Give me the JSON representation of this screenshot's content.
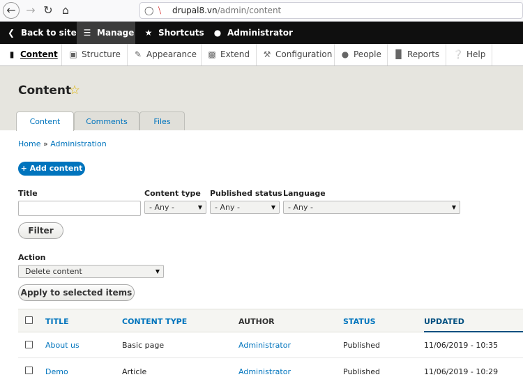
{
  "browser": {
    "url_host": "drupal8.vn",
    "url_path": "/admin/content",
    "back_icon": "back-arrow-icon",
    "forward_icon": "forward-arrow-icon",
    "reload_icon": "reload-icon",
    "home_icon": "home-icon"
  },
  "toolbar": {
    "back_to_site": "Back to site",
    "manage": "Manage",
    "shortcuts": "Shortcuts",
    "user": "Administrator"
  },
  "tray": {
    "items": [
      {
        "label": "Content",
        "icon": "document-icon"
      },
      {
        "label": "Structure",
        "icon": "sitemap-icon"
      },
      {
        "label": "Appearance",
        "icon": "paint-icon"
      },
      {
        "label": "Extend",
        "icon": "puzzle-icon"
      },
      {
        "label": "Configuration",
        "icon": "wrench-icon"
      },
      {
        "label": "People",
        "icon": "people-icon"
      },
      {
        "label": "Reports",
        "icon": "bar-chart-icon"
      },
      {
        "label": "Help",
        "icon": "help-icon"
      }
    ]
  },
  "page": {
    "title": "Content",
    "tabs": [
      {
        "label": "Content"
      },
      {
        "label": "Comments"
      },
      {
        "label": "Files"
      }
    ],
    "breadcrumb": {
      "home": "Home",
      "sep": "»",
      "admin": "Administration"
    },
    "add_button": "+ Add content"
  },
  "filters": {
    "title_label": "Title",
    "title_value": "",
    "content_type_label": "Content type",
    "content_type_value": "- Any -",
    "status_label": "Published status",
    "status_value": "- Any -",
    "language_label": "Language",
    "language_value": "- Any -",
    "filter_button": "Filter"
  },
  "bulk": {
    "action_label": "Action",
    "action_value": "Delete content",
    "apply_button": "Apply to selected items"
  },
  "table": {
    "headers": {
      "title": "TITLE",
      "content_type": "CONTENT TYPE",
      "author": "AUTHOR",
      "status": "STATUS",
      "updated": "UPDATED"
    },
    "rows": [
      {
        "title": "About us",
        "type": "Basic page",
        "author": "Administrator",
        "status": "Published",
        "updated": "11/06/2019 - 10:35"
      },
      {
        "title": "Demo",
        "type": "Article",
        "author": "Administrator",
        "status": "Published",
        "updated": "11/06/2019 - 10:29"
      }
    ]
  },
  "colors": {
    "link": "#0074bd",
    "toolbar": "#0f0f0f",
    "header_bg": "#e6e5df",
    "primary_button": "#0074bd"
  }
}
